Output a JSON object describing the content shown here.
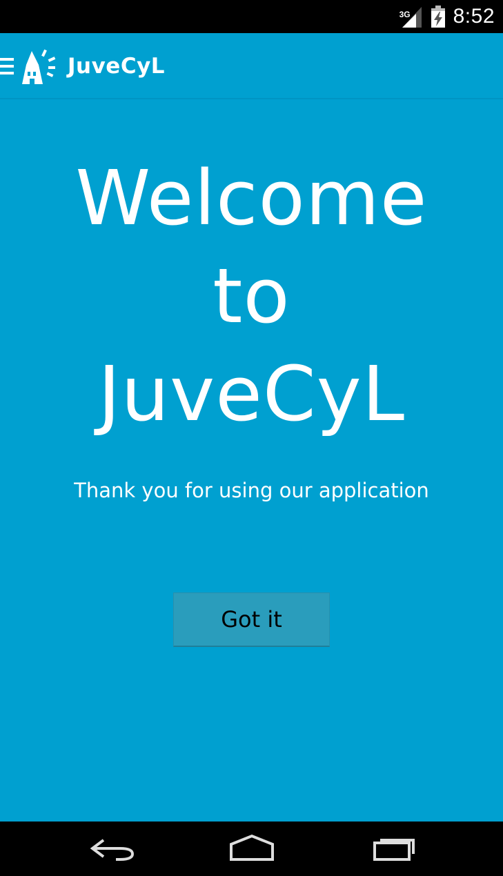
{
  "status_bar": {
    "network_type": "3G",
    "time": "8:52",
    "icons": [
      "signal-icon",
      "battery-charging-icon"
    ]
  },
  "app_bar": {
    "title": "JuveCyL",
    "icons": [
      "menu-icon",
      "juvecyl-logo-icon"
    ]
  },
  "welcome": {
    "line1": "Welcome",
    "line2": "to",
    "line3": "JuveCyL",
    "subtitle": "Thank you for using our application",
    "button_label": "Got it"
  },
  "nav_bar": {
    "icons": [
      "back-icon",
      "home-icon",
      "recent-apps-icon"
    ]
  },
  "colors": {
    "background": "#00a0d0",
    "button": "#2a9dbc",
    "system_bars": "#000000",
    "text": "#ffffff"
  }
}
